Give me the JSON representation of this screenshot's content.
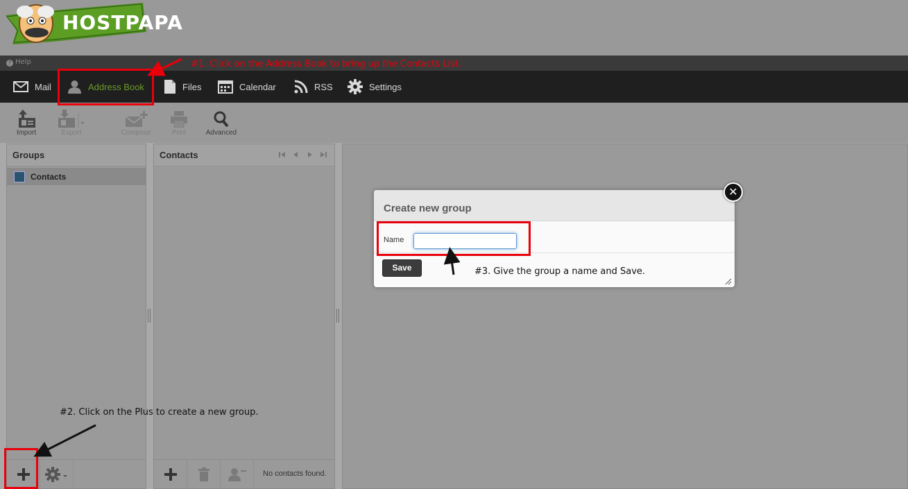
{
  "brand": {
    "name": "HOSTPAPA"
  },
  "helpbar": {
    "help_label": "Help"
  },
  "nav": {
    "items": [
      {
        "label": "Mail",
        "icon": "mail-icon"
      },
      {
        "label": "Address Book",
        "icon": "person-icon",
        "active": true
      },
      {
        "label": "Files",
        "icon": "file-icon"
      },
      {
        "label": "Calendar",
        "icon": "calendar-icon"
      },
      {
        "label": "RSS",
        "icon": "rss-icon"
      },
      {
        "label": "Settings",
        "icon": "gear-icon"
      }
    ]
  },
  "toolbar": {
    "import": "Import",
    "export": "Export",
    "compose": "Compose",
    "print": "Print",
    "advanced": "Advanced"
  },
  "groups_panel": {
    "title": "Groups",
    "items": [
      {
        "label": "Contacts"
      }
    ]
  },
  "contacts_panel": {
    "title": "Contacts",
    "status": "No contacts found."
  },
  "dialog": {
    "title": "Create new group",
    "name_label": "Name",
    "name_value": "",
    "save_label": "Save"
  },
  "annotations": {
    "step1": "#1. Click on the Address Book to bring up the Contacts List.",
    "step2": "#2. Click on the Plus to create a new group.",
    "step3": "#3. Give the group a name and Save."
  },
  "colors": {
    "accent_green": "#6a9a2a",
    "annotation_red": "#e8000a",
    "navbar": "#1f1f1f"
  }
}
